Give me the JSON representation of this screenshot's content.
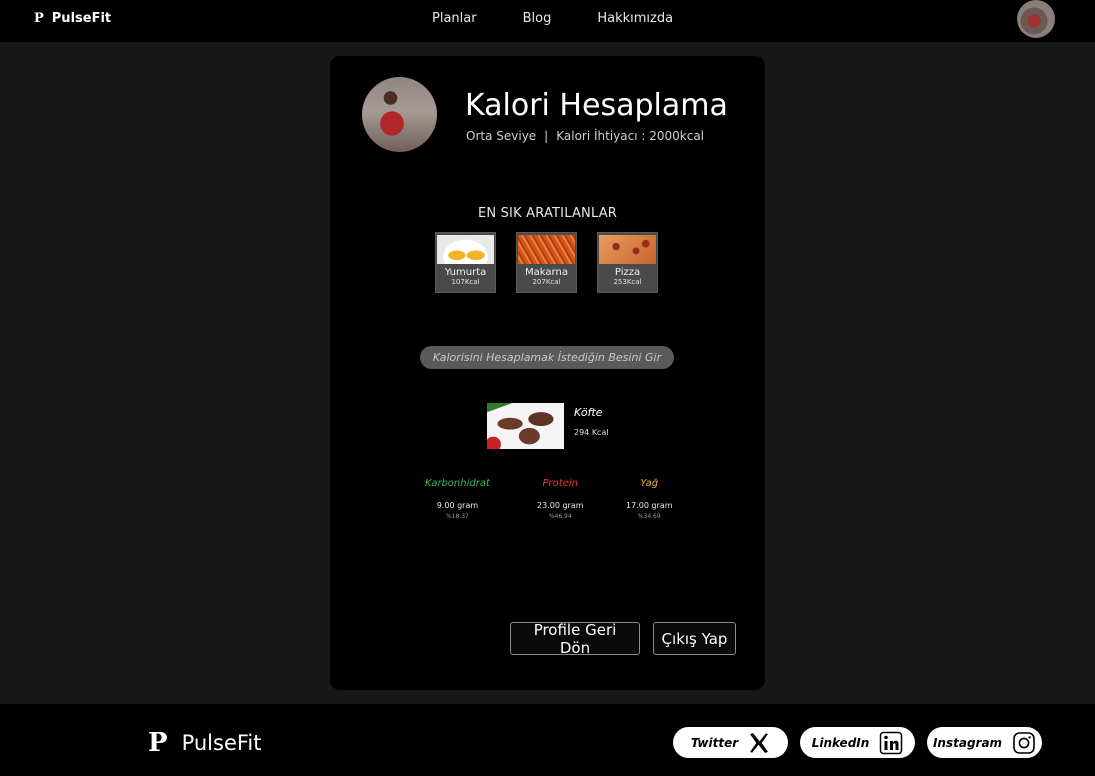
{
  "nav": {
    "brand_mark": "P",
    "brand_name": "PulseFit",
    "links": [
      "Planlar",
      "Blog",
      "Hakkımızda"
    ]
  },
  "card": {
    "title": "Kalori Hesaplama",
    "level": "Orta Seviye",
    "separator": "|",
    "calorie_need": "Kalori İhtiyacı : 2000kcal",
    "popular_title": "EN SIK ARATILANLAR",
    "popular_items": [
      {
        "name": "Yumurta",
        "kcal": "107Kcal",
        "icon": "egg-image"
      },
      {
        "name": "Makarna",
        "kcal": "207Kcal",
        "icon": "pasta-image"
      },
      {
        "name": "Pizza",
        "kcal": "253Kcal",
        "icon": "pizza-image"
      }
    ],
    "search_placeholder": "Kalorisini Hesaplamak İstediğin Besini Gir",
    "result": {
      "name": "Köfte",
      "kcal": "294 Kcal"
    },
    "macros": [
      {
        "label": "Karbonhidrat",
        "gram": "9.00 gram",
        "pct": "%18.37",
        "color": "#39b85a"
      },
      {
        "label": "Protein",
        "gram": "23.00 gram",
        "pct": "%46.94",
        "color": "#e53935"
      },
      {
        "label": "Yağ",
        "gram": "17.00 gram",
        "pct": "%34.69",
        "color": "#f0b43a"
      }
    ],
    "buttons": {
      "profile": "Profile Geri Dön",
      "logout": "Çıkış Yap"
    }
  },
  "footer": {
    "logo": "P",
    "name": "PulseFit",
    "socials": [
      {
        "label": "Twitter",
        "icon": "x-icon"
      },
      {
        "label": "LinkedIn",
        "icon": "linkedin-icon"
      },
      {
        "label": "Instagram",
        "icon": "instagram-icon"
      }
    ]
  }
}
